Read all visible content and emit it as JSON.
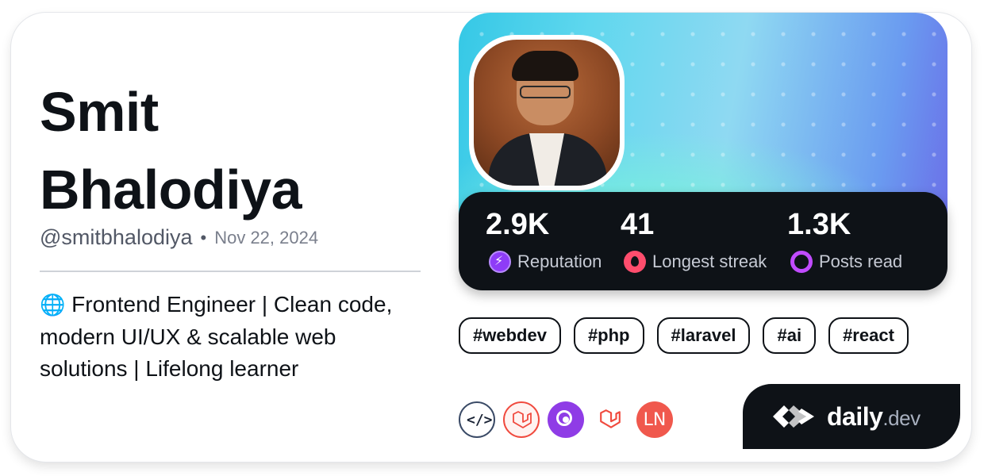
{
  "profile": {
    "name_line1": "Smit",
    "name_line2": "Bhalodiya",
    "handle": "@smitbhalodiya",
    "separator": "•",
    "joined": "Nov 22, 2024",
    "bio_icon": "🌐",
    "bio": "Frontend Engineer | Clean code, modern UI/UX & scalable web solutions | Lifelong learner"
  },
  "stats": [
    {
      "value": "2.9K",
      "label": "Reputation",
      "icon": "lightning-icon"
    },
    {
      "value": "41",
      "label": "Longest streak",
      "icon": "flame-icon"
    },
    {
      "value": "1.3K",
      "label": "Posts read",
      "icon": "reading-ring-icon"
    }
  ],
  "tags": [
    "#webdev",
    "#php",
    "#laravel",
    "#ai",
    "#react"
  ],
  "sources": [
    {
      "icon": "code-icon"
    },
    {
      "icon": "laravel-icon"
    },
    {
      "icon": "target-icon"
    },
    {
      "icon": "laravel-icon"
    },
    {
      "icon": "ln-icon",
      "text": "LN"
    }
  ],
  "brand": {
    "name": "daily",
    "tld": ".dev"
  },
  "colors": {
    "dark": "#0e1217",
    "reputation": "#8e3cf7",
    "streak": "#ff4d6d",
    "posts": "#c14bff",
    "laravel": "#f04a3e"
  }
}
